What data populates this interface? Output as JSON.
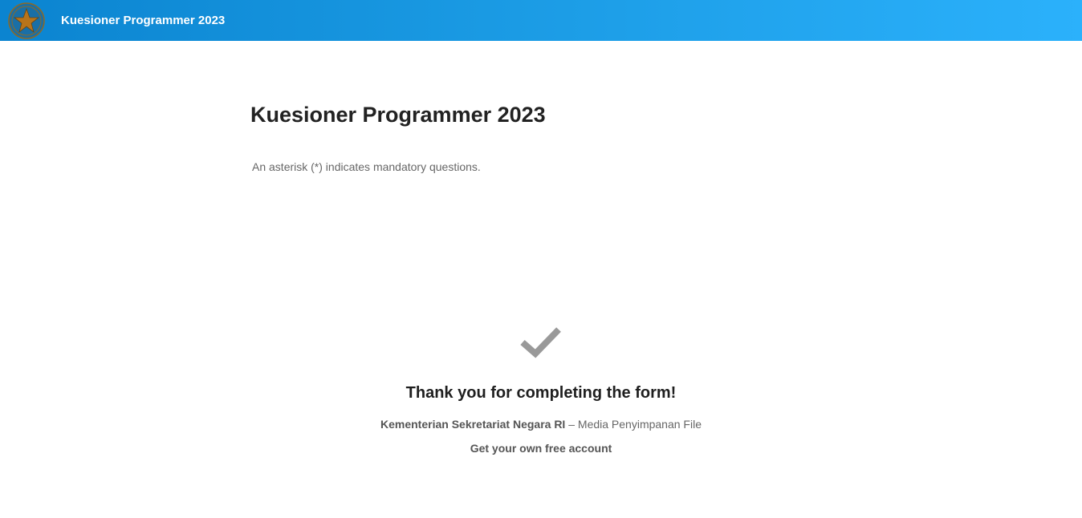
{
  "header": {
    "logo_icon": "garuda-star-emblem-icon",
    "title": "Kuesioner Programmer 2023",
    "gradient_start": "#0b84d0",
    "gradient_end": "#2bb1fb"
  },
  "form": {
    "title": "Kuesioner Programmer 2023",
    "mandatory_note": "An asterisk (*) indicates mandatory questions."
  },
  "confirmation": {
    "check_icon": "checkmark-icon",
    "check_color": "#999999",
    "thanks_title": "Thank you for completing the form!",
    "organization": "Kementerian Sekretariat Negara RI",
    "separator": " – ",
    "service_name": "Media Penyimpanan File",
    "free_account_link": "Get your own free account"
  }
}
